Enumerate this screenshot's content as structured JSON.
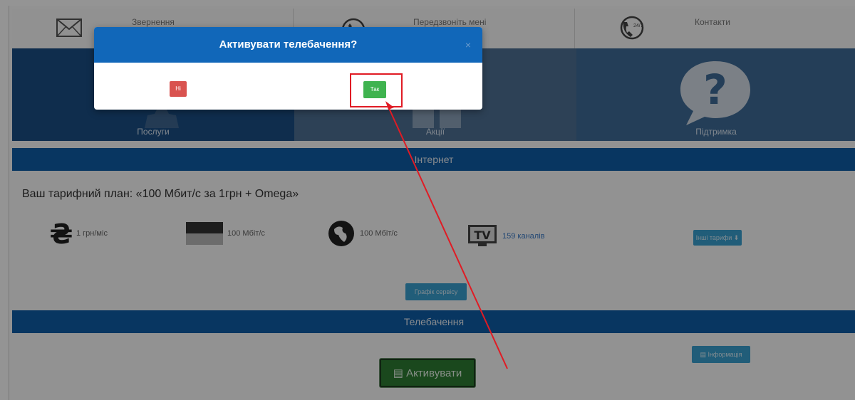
{
  "topbar": {
    "items": [
      {
        "label": "Звернення",
        "icon": "envelope-icon"
      },
      {
        "label": "Передзвоніть мені",
        "icon": "phone-callback-icon"
      },
      {
        "label": "Контакти",
        "icon": "phone-24-7-icon",
        "badge": "24/7"
      }
    ]
  },
  "tiles": {
    "services": "Послуги",
    "promo": "Акції",
    "support": "Підтримка"
  },
  "internet": {
    "section_title": "Інтернет",
    "plan_title": "Ваш тарифний план: «100 Мбит/с за 1грн + Omega»",
    "price": "1 грн/міс",
    "speed1": "100 Мбіт/с",
    "speed2": "100 Мбіт/с",
    "tv_icon_text": "TV",
    "channels": "159 каналів",
    "all_tariffs": "Інші тарифи ⬇",
    "schedule": "Графік сервісу"
  },
  "tv": {
    "section_title": "Телебачення",
    "info_button": "▤ Інформація",
    "activate_button": "▤ Активувати"
  },
  "modal": {
    "title": "Активувати телебачення?",
    "close": "×",
    "no_button": "Ні",
    "yes_button": "Так"
  },
  "colors": {
    "header_blue": "#1167b9",
    "section_blue": "#0f5ea7",
    "yes_green": "#3fb34f",
    "no_red": "#d9534f",
    "highlight_red": "#e01b24"
  }
}
